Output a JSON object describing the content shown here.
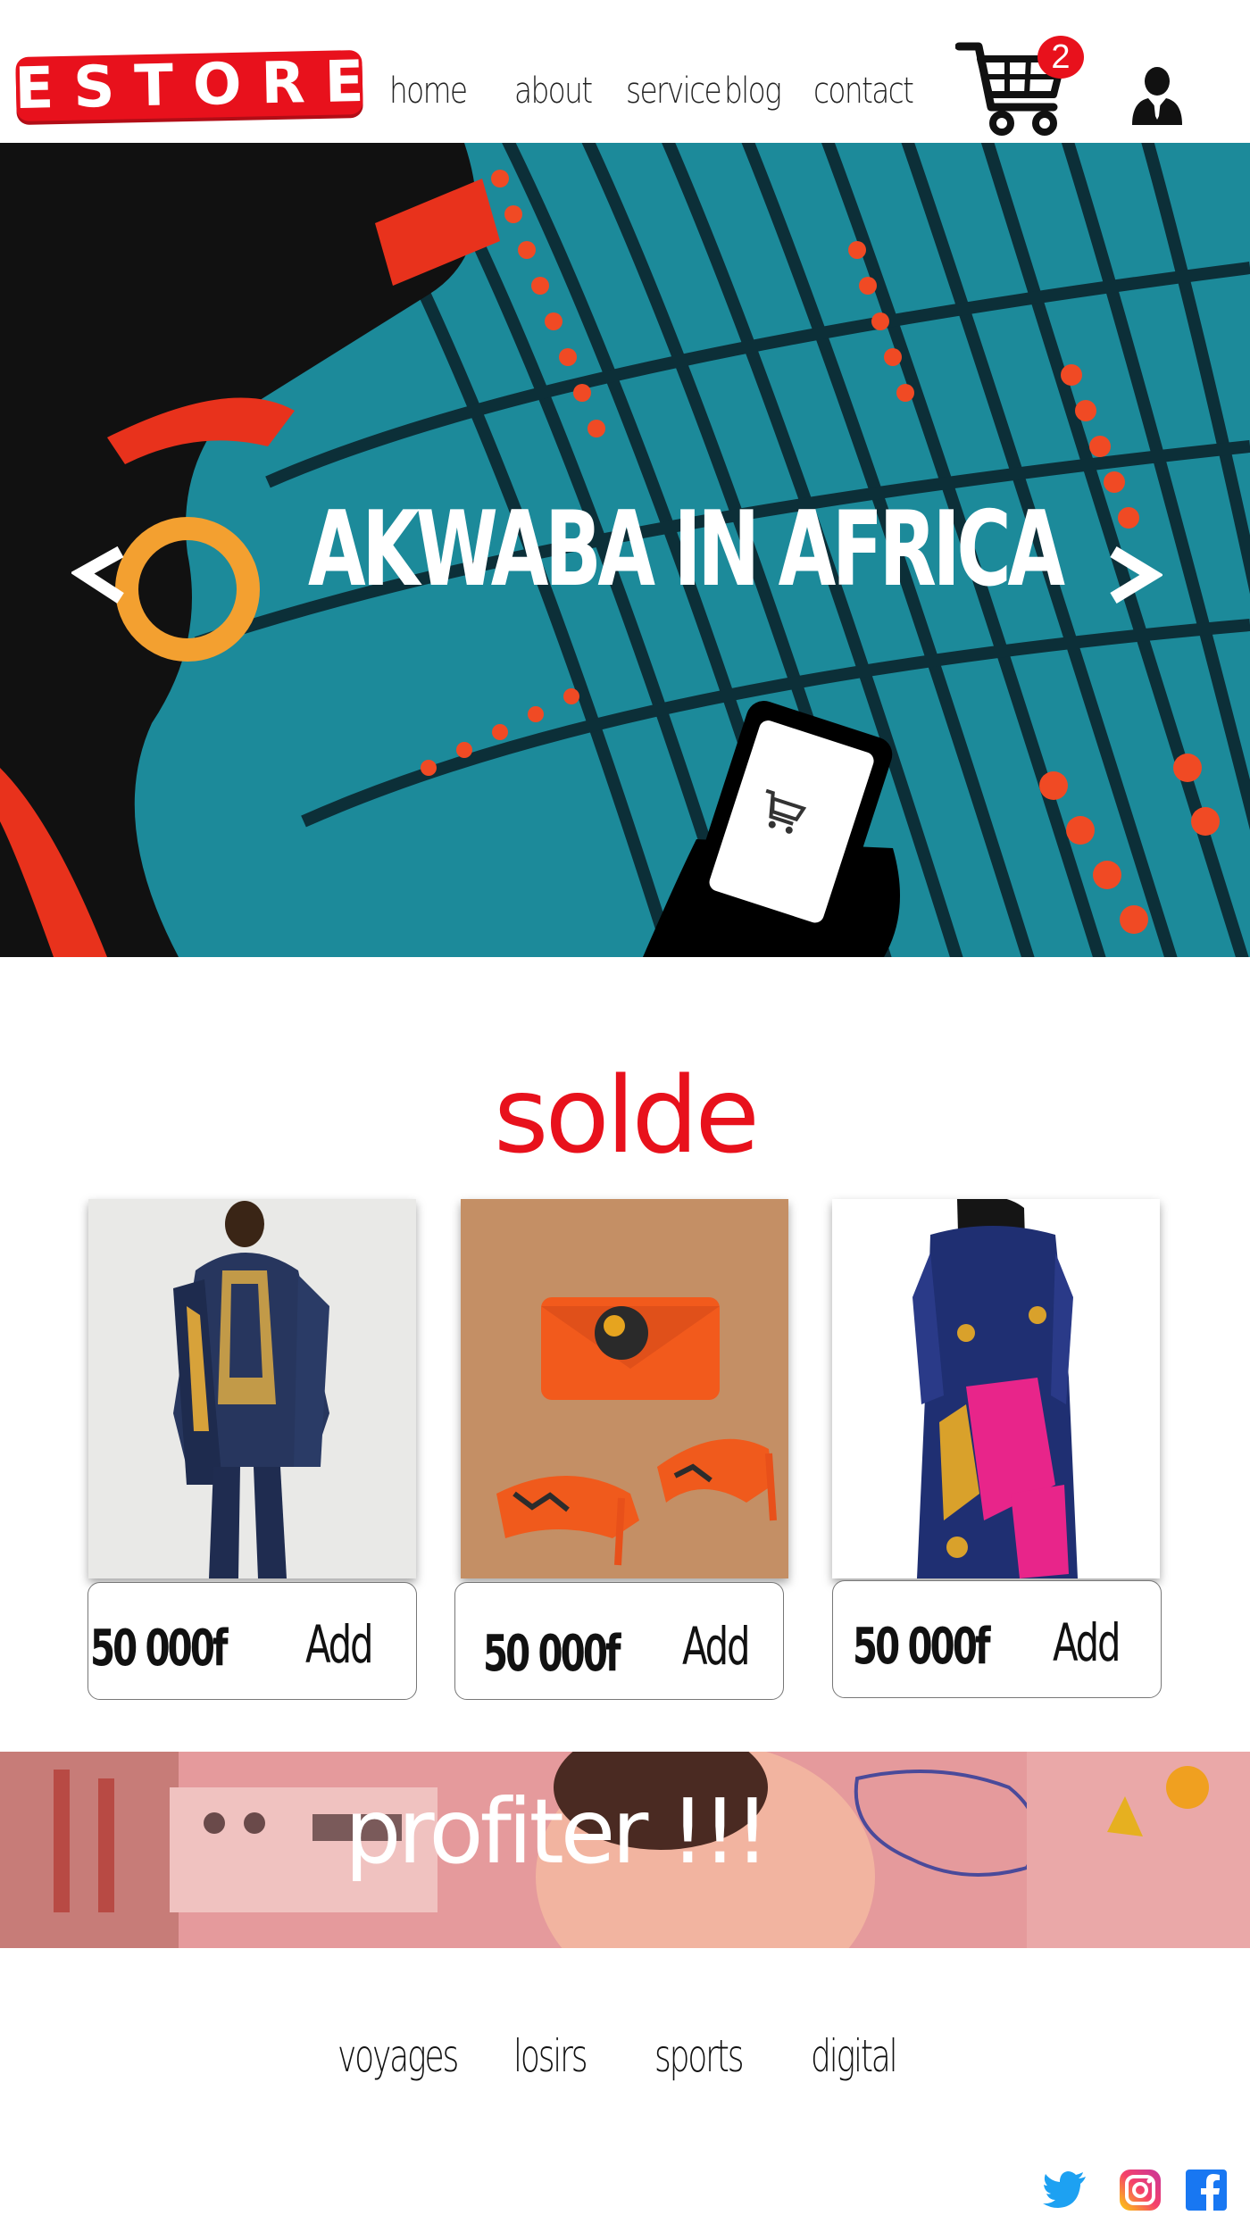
{
  "header": {
    "logo_text": "ESTORE",
    "nav": [
      "home",
      "about",
      "service",
      "blog",
      "contact"
    ],
    "cart_count": "2",
    "icons": {
      "cart": "shopping-cart-icon",
      "user": "user-icon"
    },
    "colors": {
      "brand": "#e8111c"
    }
  },
  "hero": {
    "title": "AKWABA IN AFRICA",
    "prev_icon": "chevron-left-icon",
    "next_icon": "chevron-right-icon"
  },
  "sale": {
    "title": "solde",
    "products": [
      {
        "price": "50 000f",
        "add_label": "Add",
        "image": "man-in-blue-african-outfit"
      },
      {
        "price": "50 000f",
        "add_label": "Add",
        "image": "orange-wax-print-clutch-and-heels"
      },
      {
        "price": "50 000f",
        "add_label": "Add",
        "image": "woman-in-patterned-dress"
      }
    ]
  },
  "promo": {
    "text": "profiter   !!!"
  },
  "categories": [
    "voyages",
    "losirs",
    "sports",
    "digital"
  ],
  "social": [
    "twitter-icon",
    "instagram-icon",
    "facebook-icon"
  ]
}
